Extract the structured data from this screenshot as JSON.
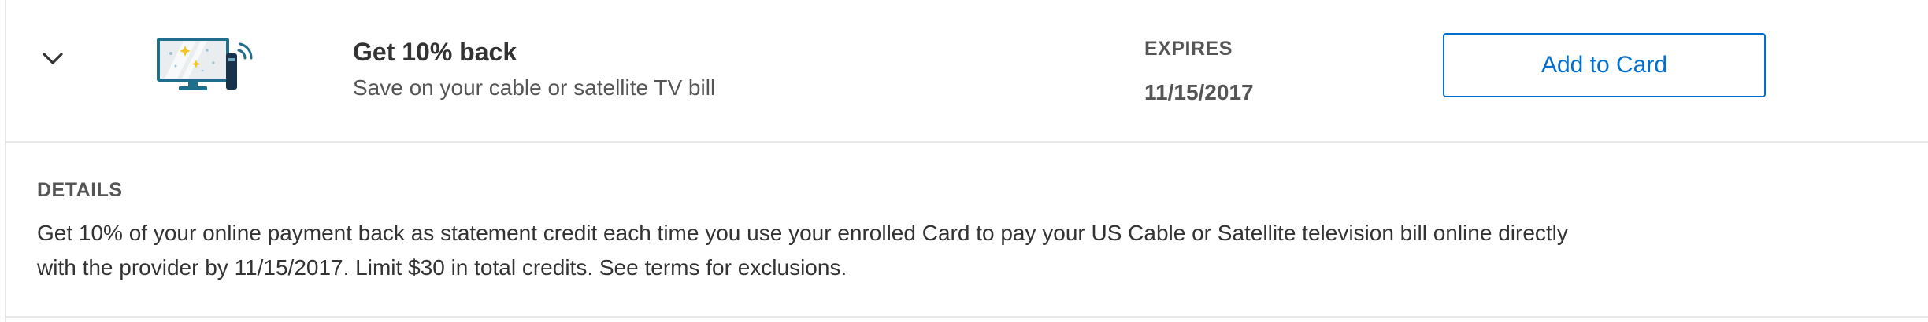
{
  "offer": {
    "title": "Get 10% back",
    "subtitle": "Save on your cable or satellite TV bill",
    "expires_label": "EXPIRES",
    "expires_date": "11/15/2017",
    "add_button_label": "Add to Card",
    "thumbnail_icon": "tv-remote-icon",
    "toggle_icon": "chevron-down-icon"
  },
  "details": {
    "label": "DETAILS",
    "text": "Get 10% of your online payment back as statement credit each time you use your enrolled Card to pay your US Cable or Satellite television bill online directly with the provider by 11/15/2017. Limit $30 in total credits. See terms for exclusions."
  },
  "colors": {
    "accent": "#006fcf",
    "text": "#333333",
    "muted": "#555555",
    "divider": "#e8e8e8"
  }
}
